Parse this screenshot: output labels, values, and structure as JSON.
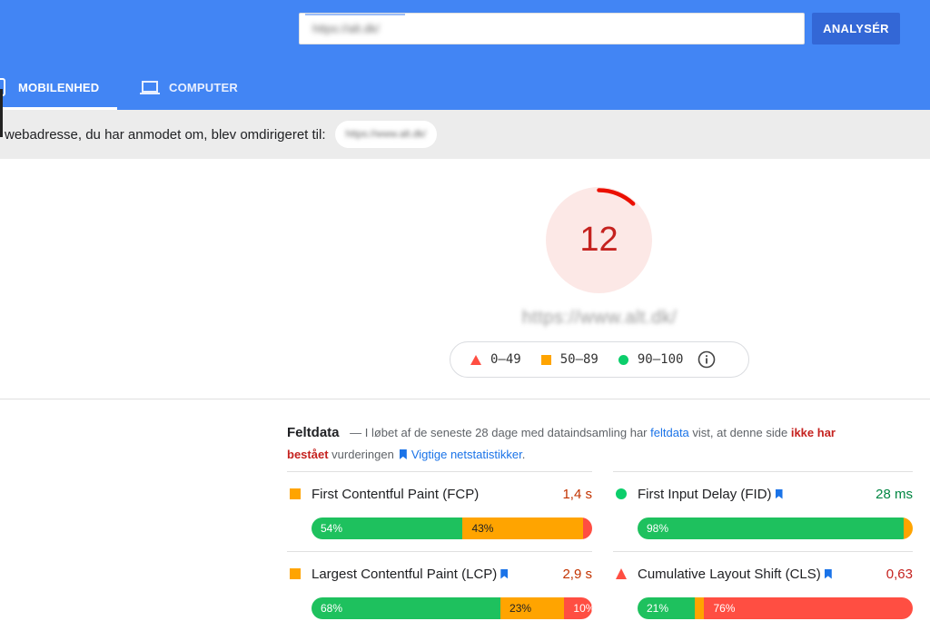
{
  "header": {
    "url_input_value": "https://alt.dk/",
    "analyze_label": "ANALYSÉR"
  },
  "tabs": [
    {
      "label": "MOBILENHED",
      "icon": "smartphone-icon",
      "active": true
    },
    {
      "label": "COMPUTER",
      "icon": "laptop-icon",
      "active": false
    }
  ],
  "redirect": {
    "text": "webadresse, du har anmodet om, blev omdirigeret til:",
    "url": "https://www.alt.dk/"
  },
  "score": {
    "value": "12",
    "fraction": 0.12,
    "url": "https://www.alt.dk/",
    "color": "#c5221f",
    "track_color": "#fce8e6"
  },
  "legend": [
    {
      "label": "0–49",
      "icon": "triangle-icon",
      "color": "#ff4e42"
    },
    {
      "label": "50–89",
      "icon": "square-icon",
      "color": "#ffa400"
    },
    {
      "label": "90–100",
      "icon": "circle-icon",
      "color": "#0cce6b"
    }
  ],
  "field_data": {
    "title": "Feltdata",
    "text_1": "— I løbet af de seneste 28 dage med dataindsamling har",
    "link_feltdata": "feltdata",
    "text_2": "vist, at denne side",
    "verdict": "ikke har bestået",
    "text_3": "vurderingen",
    "link_vitals": "Vigtige netstatistikker",
    "text_4": "."
  },
  "metrics": [
    {
      "name": "First Contentful Paint (FCP)",
      "value": "1,4 s",
      "status": "average",
      "value_color": "#c33300",
      "bookmark": false,
      "distribution": [
        {
          "label": "54%",
          "value": 54
        },
        {
          "label": "43%",
          "value": 43
        },
        {
          "label": "3%",
          "value": 3
        }
      ]
    },
    {
      "name": "First Input Delay (FID)",
      "value": "28 ms",
      "status": "good",
      "value_color": "#018642",
      "bookmark": true,
      "distribution": [
        {
          "label": "98%",
          "value": 98
        },
        {
          "label": "2%",
          "value": 2
        },
        {
          "label": "",
          "value": 0
        }
      ]
    },
    {
      "name": "Largest Contentful Paint (LCP)",
      "value": "2,9 s",
      "status": "average",
      "value_color": "#c33300",
      "bookmark": true,
      "distribution": [
        {
          "label": "68%",
          "value": 68
        },
        {
          "label": "23%",
          "value": 23
        },
        {
          "label": "10%",
          "value": 10
        }
      ]
    },
    {
      "name": "Cumulative Layout Shift (CLS)",
      "value": "0,63",
      "status": "poor",
      "value_color": "#c5221f",
      "bookmark": true,
      "distribution": [
        {
          "label": "21%",
          "value": 21
        },
        {
          "label": "3%",
          "value": 3
        },
        {
          "label": "76%",
          "value": 76
        }
      ]
    }
  ]
}
